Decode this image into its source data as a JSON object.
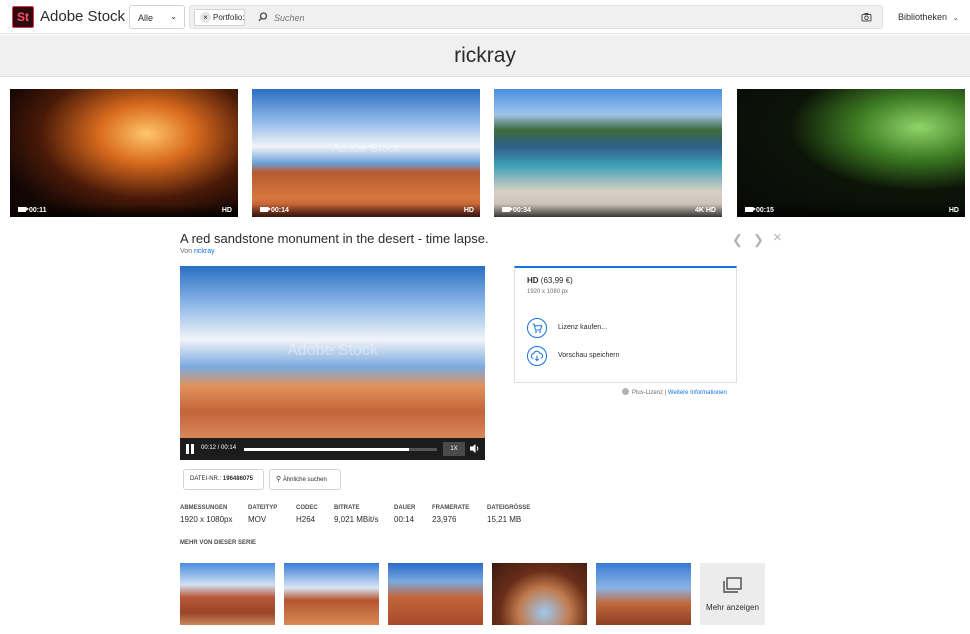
{
  "app": {
    "title": "Adobe Stock",
    "logo_text": "St"
  },
  "header": {
    "filter_select": "Alle",
    "chip_label": "Portfolio:",
    "search_placeholder": "Suchen",
    "libraries_label": "Bibliotheken"
  },
  "page_title": "rickray",
  "thumbnails": [
    {
      "duration": "00:11",
      "quality": "HD"
    },
    {
      "duration": "00:14",
      "quality": "HD"
    },
    {
      "duration": "00:34",
      "quality": "4K HD"
    },
    {
      "duration": "00:15",
      "quality": "HD"
    }
  ],
  "watermark": "Adobe Stock",
  "detail": {
    "title": "A red sandstone monument in the desert - time lapse.",
    "by_prefix": "Von",
    "author": "rickray"
  },
  "player": {
    "time": "00:12 / 00:14",
    "progress": 0.857,
    "speed": "1X"
  },
  "license": {
    "name": "HD",
    "price": "(63,99 €)",
    "resolution": "1920 x 1080 px",
    "buy_label": "Lizenz kaufen...",
    "save_label": "Vorschau speichern"
  },
  "plus_license": {
    "text": "Plus-Lizenz |",
    "link": "Weitere Informationen"
  },
  "buttons": {
    "file_no_label": "DATEI-NR.:",
    "file_no": "196486075",
    "similar": "Ähnliche suchen"
  },
  "metadata": [
    {
      "key": "ABMESSUNGEN",
      "value": "1920 x 1080px"
    },
    {
      "key": "DATEITYP",
      "value": "MOV"
    },
    {
      "key": "CODEC",
      "value": "H264"
    },
    {
      "key": "BITRATE",
      "value": "9,021 MBit/s"
    },
    {
      "key": "DAUER",
      "value": "00:14"
    },
    {
      "key": "FRAMERATE",
      "value": "23,976"
    },
    {
      "key": "DATEIGRÖSSE",
      "value": "15,21 MB"
    }
  ],
  "series": {
    "title": "MEHR VON DIESER SERIE",
    "more_label": "Mehr anzeigen"
  },
  "colors": {
    "accent": "#1473e6",
    "brand": "#ff4f6a"
  }
}
